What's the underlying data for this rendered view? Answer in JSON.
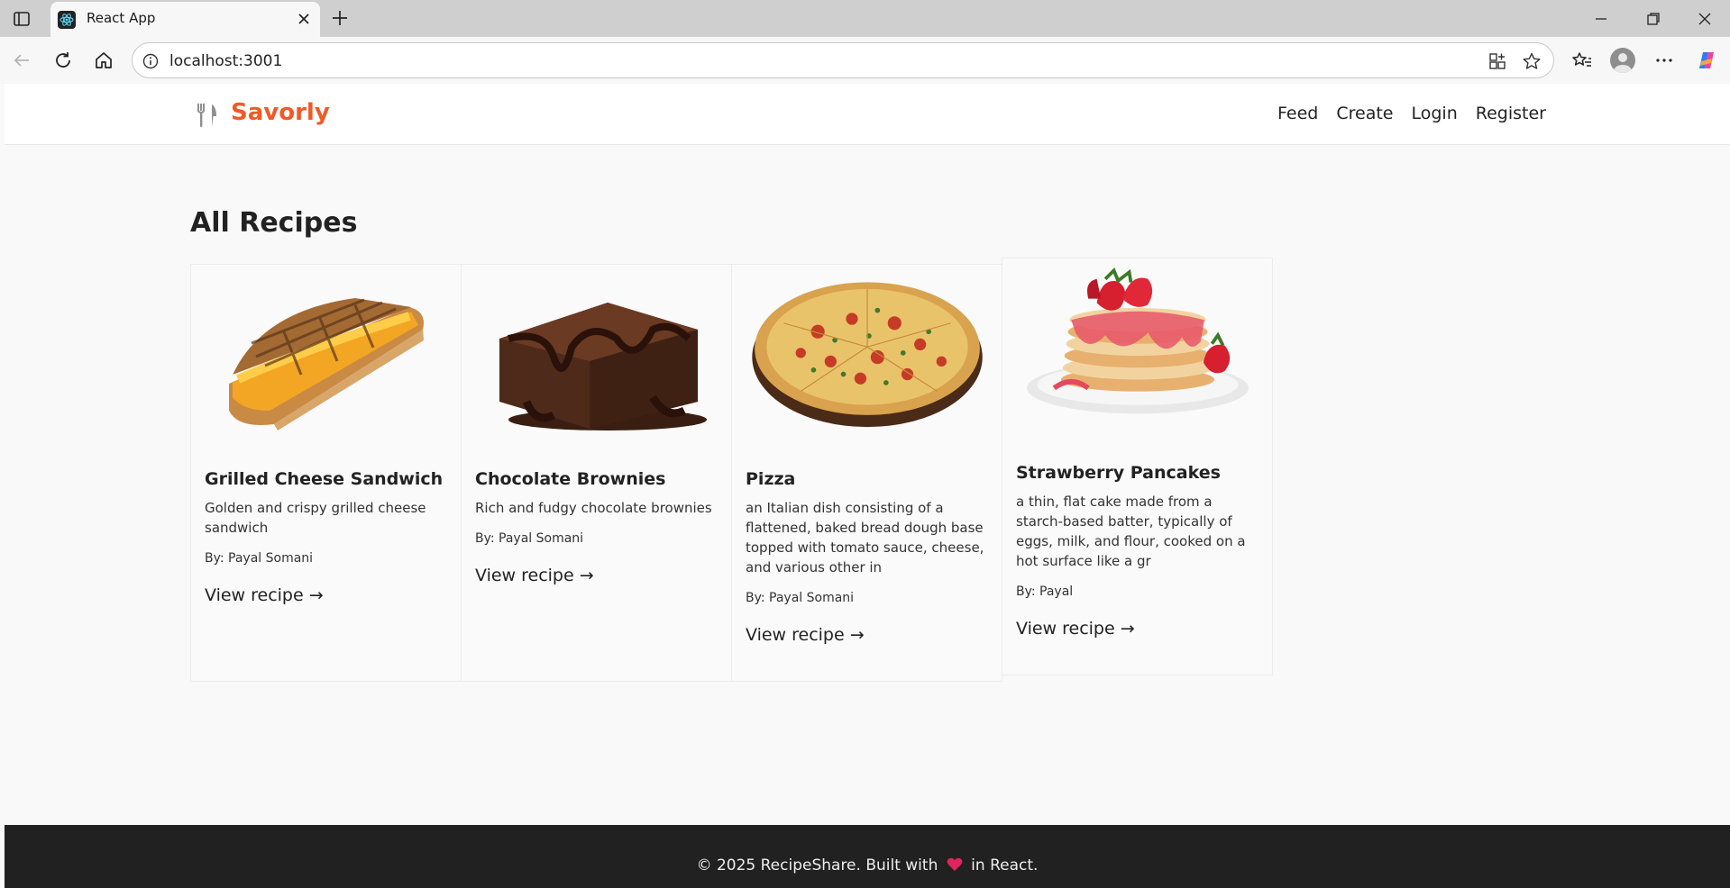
{
  "browser": {
    "tab_title": "React App",
    "url": "localhost:3001"
  },
  "site": {
    "logo": "Savorly",
    "nav": [
      {
        "label": "Feed"
      },
      {
        "label": "Create"
      },
      {
        "label": "Login"
      },
      {
        "label": "Register"
      }
    ]
  },
  "main": {
    "title": "All Recipes",
    "recipes": [
      {
        "title": "Grilled Cheese Sandwich",
        "description": "Golden and crispy grilled cheese sandwich",
        "author": "By: Payal Somani",
        "link": "View recipe →"
      },
      {
        "title": "Chocolate Brownies",
        "description": "Rich and fudgy chocolate brownies",
        "author": "By: Payal Somani",
        "link": "View recipe →"
      },
      {
        "title": "Pizza",
        "description": "an Italian dish consisting of a flattened, baked bread dough base topped with tomato sauce, cheese, and various other in",
        "author": "By: Payal Somani",
        "link": "View recipe →"
      },
      {
        "title": "Strawberry Pancakes",
        "description": "a thin, flat cake made from a starch-based batter, typically of eggs, milk, and flour, cooked on a hot surface like a gr",
        "author": "By: Payal",
        "link": "View recipe →"
      }
    ]
  },
  "footer": {
    "text_before": "© 2025 RecipeShare. Built with",
    "text_after": "in React."
  },
  "colors": {
    "brand": "#f05a28",
    "footer_bg": "#212121",
    "heart": "#e0245e"
  }
}
